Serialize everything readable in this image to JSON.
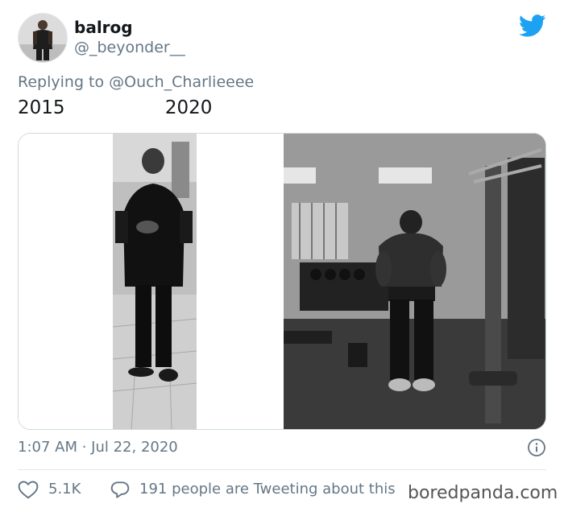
{
  "author": {
    "display_name": "balrog",
    "handle": "@_beyonder__"
  },
  "reply": {
    "prefix": "Replying to ",
    "mention": "@Ouch_Charlieeee"
  },
  "tweet_text": "2015                 2020",
  "media": {
    "left_photo": "2015 photo",
    "right_photo": "2020 photo"
  },
  "timestamp": "1:07 AM · Jul 22, 2020",
  "actions": {
    "like_count": "5.1K",
    "reply_text": "191 people are Tweeting about this"
  },
  "watermark": "boredpanda.com",
  "colors": {
    "twitter_blue": "#1da1f2",
    "secondary_text": "#657786"
  }
}
